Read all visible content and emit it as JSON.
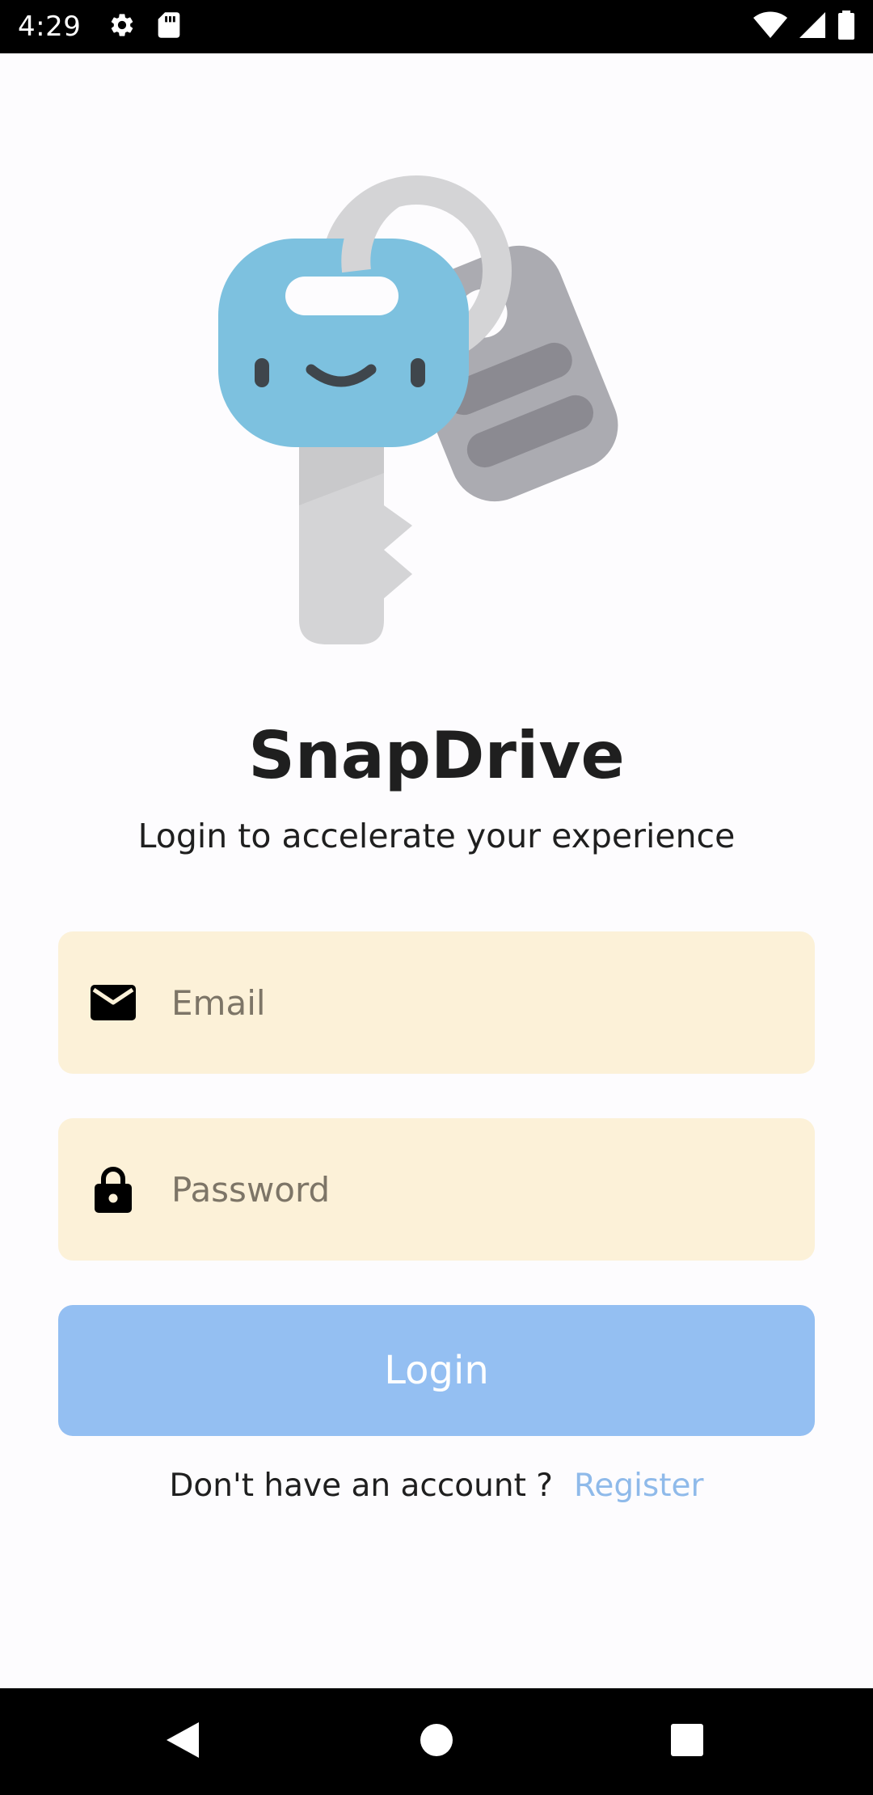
{
  "status_bar": {
    "time": "4:29",
    "icons": [
      "gear-icon",
      "sd-card-icon",
      "wifi-icon",
      "cell-signal-icon",
      "battery-icon"
    ]
  },
  "app": {
    "title": "SnapDrive",
    "subtitle": "Login to accelerate your experience"
  },
  "form": {
    "email": {
      "placeholder": "Email",
      "value": "",
      "icon": "mail-icon"
    },
    "password": {
      "placeholder": "Password",
      "value": "",
      "icon": "lock-icon"
    },
    "login_label": "Login"
  },
  "register": {
    "prompt": "Don't have an account ?",
    "link_label": "Register"
  },
  "nav_bar": {
    "icons": [
      "back-icon",
      "home-icon",
      "recents-icon"
    ]
  },
  "colors": {
    "field_bg": "#fcf1d8",
    "button_bg": "#94bff2",
    "link": "#8fbaea",
    "key_blue": "#7dc1df"
  }
}
